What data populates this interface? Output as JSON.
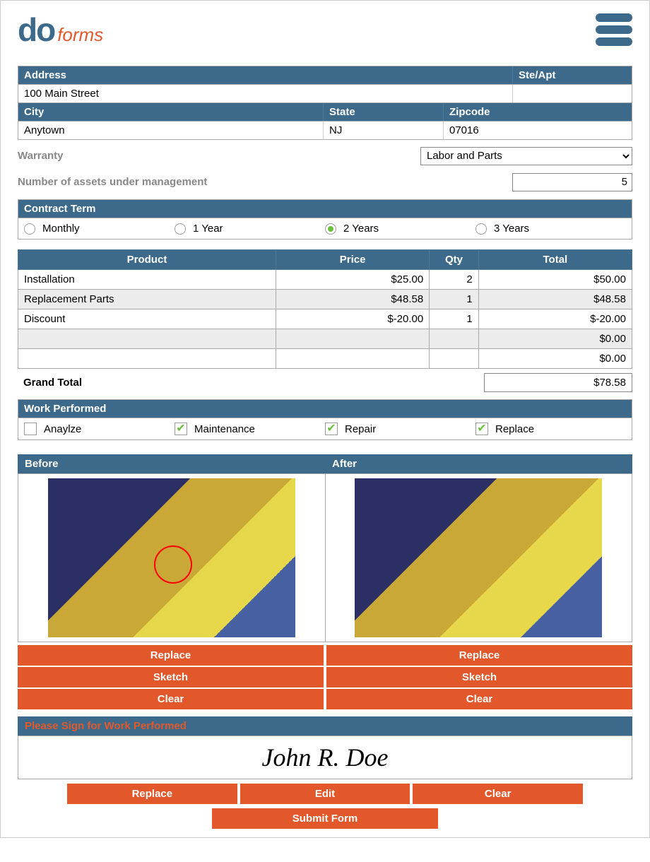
{
  "brand": {
    "do": "do",
    "forms": "forms"
  },
  "address": {
    "labels": {
      "address": "Address",
      "ste": "Ste/Apt",
      "city": "City",
      "state": "State",
      "zip": "Zipcode"
    },
    "values": {
      "address": "100 Main Street",
      "ste": "",
      "city": "Anytown",
      "state": "NJ",
      "zip": "07016"
    }
  },
  "warranty": {
    "label": "Warranty",
    "selected": "Labor and Parts"
  },
  "assets": {
    "label": "Number of assets under management",
    "value": "5"
  },
  "contract": {
    "label": "Contract Term",
    "options": [
      "Monthly",
      "1 Year",
      "2 Years",
      "3 Years"
    ],
    "selected": "2 Years"
  },
  "products": {
    "headers": [
      "Product",
      "Price",
      "Qty",
      "Total"
    ],
    "rows": [
      {
        "product": "Installation",
        "price": "$25.00",
        "qty": "2",
        "total": "$50.00"
      },
      {
        "product": "Replacement Parts",
        "price": "$48.58",
        "qty": "1",
        "total": "$48.58"
      },
      {
        "product": "Discount",
        "price": "$-20.00",
        "qty": "1",
        "total": "$-20.00"
      },
      {
        "product": "",
        "price": "",
        "qty": "",
        "total": "$0.00"
      },
      {
        "product": "",
        "price": "",
        "qty": "",
        "total": "$0.00"
      }
    ],
    "grand_label": "Grand Total",
    "grand_total": "$78.58"
  },
  "work": {
    "label": "Work Performed",
    "items": [
      {
        "label": "Anaylze",
        "checked": false
      },
      {
        "label": "Maintenance",
        "checked": true
      },
      {
        "label": "Repair",
        "checked": true
      },
      {
        "label": "Replace",
        "checked": true
      }
    ]
  },
  "photos": {
    "before": "Before",
    "after": "After",
    "buttons": {
      "replace": "Replace",
      "sketch": "Sketch",
      "clear": "Clear"
    }
  },
  "signature": {
    "label": "Please Sign for Work Performed",
    "value": "John R. Doe",
    "buttons": {
      "replace": "Replace",
      "edit": "Edit",
      "clear": "Clear"
    }
  },
  "submit": "Submit Form"
}
